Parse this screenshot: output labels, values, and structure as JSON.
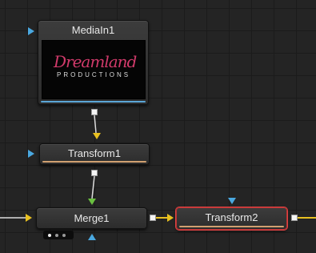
{
  "nodes": {
    "mediain1": {
      "label": "MediaIn1",
      "thumbnail": {
        "script": "Dreamland",
        "sub": "PRODUCTIONS"
      }
    },
    "transform1": {
      "label": "Transform1"
    },
    "merge1": {
      "label": "Merge1"
    },
    "transform2": {
      "label": "Transform2",
      "selected": true
    }
  },
  "colors": {
    "background": "#242424",
    "input_port_blue": "#4aa8e0",
    "input_port_yellow": "#e8c020",
    "input_port_green": "#6ac040",
    "selection_red": "#d44444",
    "source_bar": "#5aa6d6",
    "transform_bar": "#d0a070"
  },
  "icons": [
    "input-arrow-icon",
    "output-square-icon",
    "background-input-triangle-icon",
    "foreground-input-triangle-icon",
    "effect-mask-triangle-icon",
    "more-options-dots-icon"
  ]
}
